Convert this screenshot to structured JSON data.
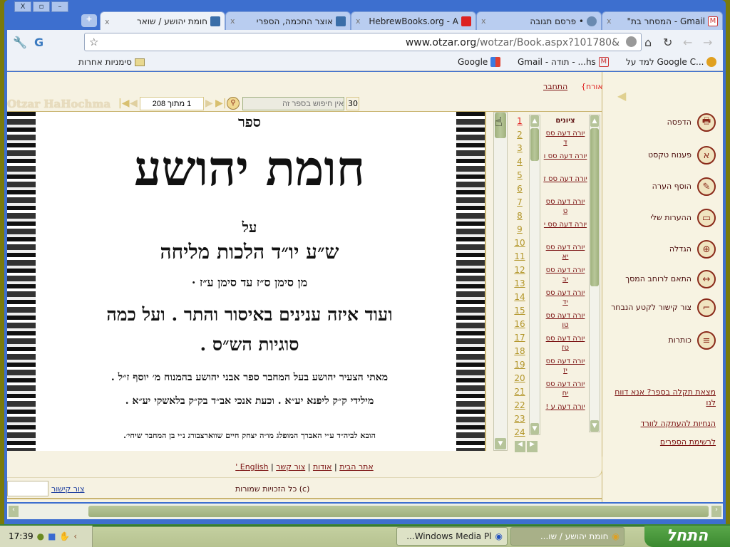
{
  "window": {
    "controls": [
      "X",
      "▫",
      "–"
    ]
  },
  "tabs": [
    {
      "label": "חומת יהושע / שואר",
      "active": true,
      "icon": "otzar-favicon"
    },
    {
      "label": "אוצר החכמה, הספרי",
      "icon": "otzar-favicon"
    },
    {
      "label": "HebrewBooks.org - A",
      "icon": "hebrewbooks-favicon"
    },
    {
      "label": "• פרסם תגובה",
      "icon": "globe-favicon"
    },
    {
      "label": "Gmail - המסחר בת\"",
      "icon": "gmail-favicon"
    }
  ],
  "new_tab": "+",
  "address": {
    "domain": "www.otzar.org",
    "path": "/wotzar/Book.aspx?101780&"
  },
  "bookmarks": {
    "other": "סימניות אחרות",
    "items": [
      "Google",
      "hs... - תודה - Gmail",
      "...Google C למד על"
    ]
  },
  "header": {
    "guest": "{אורח}",
    "login": "התחבר"
  },
  "viewer_toolbar": {
    "logo": "Otzar HaHochma",
    "page_field": "1 מתוך 208",
    "search_placeholder": "אין חיפוש בספר זה",
    "zoom": "30"
  },
  "book_page": {
    "lines": [
      "ספר",
      "חומת יהושע",
      "על",
      "ש״ע יו״ד הלכות מליחה",
      "מן סימן ס״ז עד סימן ע״ז ·",
      "ועוד איזה ענינים באיסור והתר . ועל כמה",
      "סוגיות הש״ס .",
      "מאתי הצעיר יהושע בעל המחבר ספר אבני יהושע בהמנוח מ׳ יוסף ז״ל .",
      "מילידי ק״ק ליפנא יע״א . וכעת אנכי אב״ד בק״ק בלאשקי יע״א .",
      "הובא לביה״ד ע״י האברך המופלג מו״ה יצחק חיים שווארצבורג נ״י בן המחבר שיחי׳."
    ]
  },
  "page_numbers": [
    "1",
    "2",
    "3",
    "4",
    "5",
    "6",
    "7",
    "8",
    "9",
    "10",
    "11",
    "12",
    "13",
    "14",
    "15",
    "16",
    "17",
    "18",
    "19",
    "20",
    "21",
    "22",
    "23",
    "24"
  ],
  "citations": {
    "title": "ציונים",
    "items": [
      "יורה דעה סס ד",
      "יורה דעה סס ו",
      "יורה דעה סס ז",
      "יורה דעה סס ט",
      "יורה דעה סס י",
      "יורה דעה סס יא",
      "יורה דעה סס יב",
      "יורה דעה סס יד",
      "יורה דעה סס טו",
      "יורה דעה סס טז",
      "יורה דעה סס יז",
      "יורה דעה סס יח",
      "יורה דעה ע !"
    ]
  },
  "sidebar": {
    "items": [
      {
        "label": "הדפסה",
        "icon": "printer-icon",
        "glyph": "🖶"
      },
      {
        "label": "פענוח טקסט",
        "icon": "aleph-icon",
        "glyph": "א"
      },
      {
        "label": "הוסף הערה",
        "icon": "pencil-icon",
        "glyph": "✎"
      },
      {
        "label": "ההערות שלי",
        "icon": "folder-icon",
        "glyph": "▭"
      },
      {
        "label": "הגדלה",
        "icon": "magnifier-icon",
        "glyph": "⊕"
      },
      {
        "label": "התאם לרוחב המסך",
        "icon": "fit-width-icon",
        "glyph": "↔"
      },
      {
        "label": "צור קישור לקטע הנבחר",
        "icon": "link-selection-icon",
        "glyph": "⌐"
      },
      {
        "label": "כותרות",
        "icon": "headings-icon",
        "glyph": "≡"
      }
    ],
    "links": [
      "מצאת תקלה בספר? אנא דווח לנו",
      "הנחיות להעתקה לוורד",
      "לרשימת הספרים"
    ]
  },
  "footer": {
    "links": [
      "אתר הבית",
      "אודות",
      "צור קשר",
      "English '"
    ],
    "copyright": "(c) כל הזכויות שמורות",
    "create_link": "צור קישור"
  },
  "taskbar": {
    "start": "התחל",
    "tasks": [
      "חומת יהושע / שו...",
      "Windows Media Pl..."
    ],
    "clock": "17:39"
  },
  "colors": {
    "accent": "#7a1010",
    "page_bg": "#f6f2e2",
    "scroll": "#9fb07c"
  }
}
